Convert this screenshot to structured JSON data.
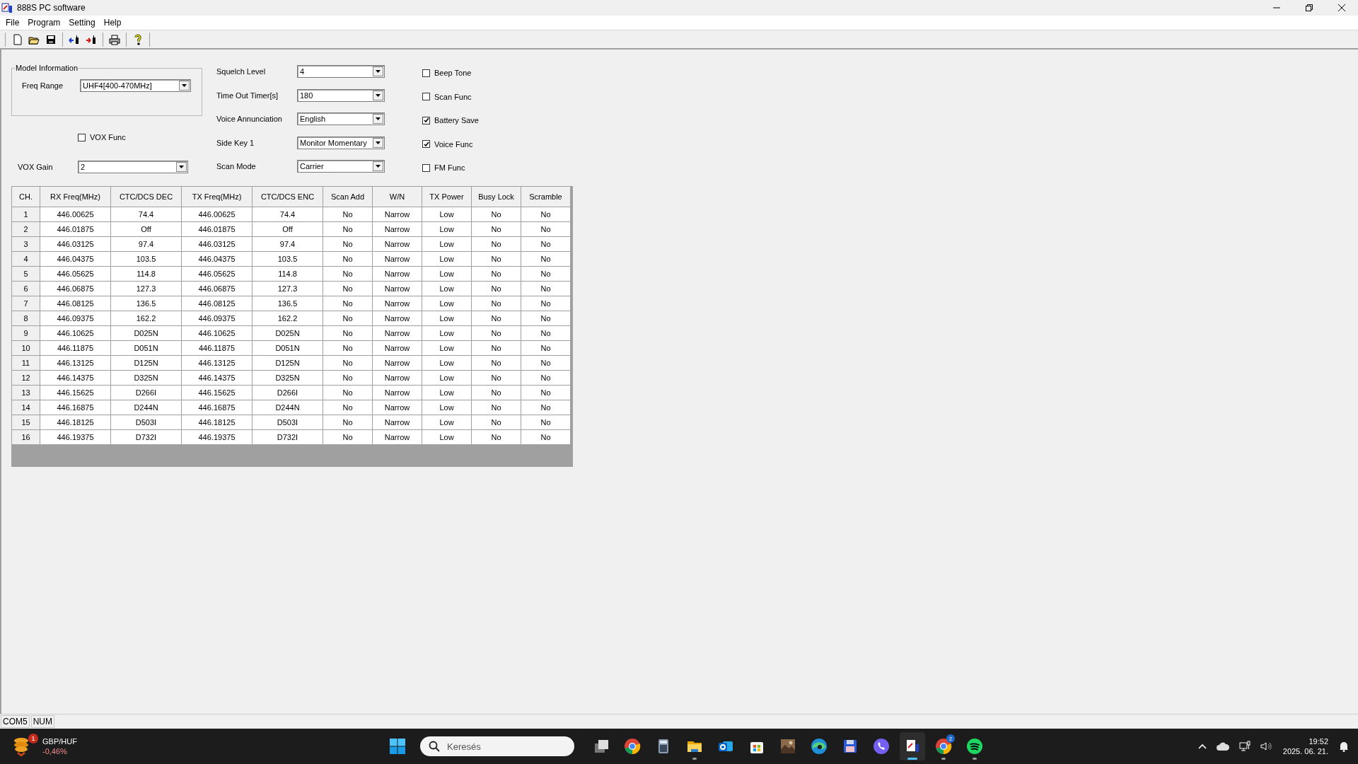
{
  "window": {
    "title": "888S PC software"
  },
  "menu": [
    "File",
    "Program",
    "Setting",
    "Help"
  ],
  "model_information": {
    "title": "Model Information",
    "freq_range": {
      "label": "Freq Range",
      "value": "UHF4[400-470MHz]"
    }
  },
  "vox_func": {
    "label": "VOX Func",
    "checked": false
  },
  "vox_gain": {
    "label": "VOX Gain",
    "value": "2"
  },
  "settings": [
    {
      "label": "Squelch Level",
      "value": "4"
    },
    {
      "label": "Time Out Timer[s]",
      "value": "180"
    },
    {
      "label": "Voice Annunciation",
      "value": "English"
    },
    {
      "label": "Side Key 1",
      "value": "Monitor Momentary"
    },
    {
      "label": "Scan Mode",
      "value": "Carrier"
    }
  ],
  "options": [
    {
      "label": "Beep Tone",
      "checked": false
    },
    {
      "label": "Scan Func",
      "checked": false
    },
    {
      "label": "Battery Save",
      "checked": true
    },
    {
      "label": "Voice Func",
      "checked": true
    },
    {
      "label": "FM Func",
      "checked": false
    }
  ],
  "table": {
    "columns": [
      "CH.",
      "RX Freq(MHz)",
      "CTC/DCS DEC",
      "TX Freq(MHz)",
      "CTC/DCS ENC",
      "Scan Add",
      "W/N",
      "TX Power",
      "Busy Lock",
      "Scramble"
    ],
    "rows": [
      [
        "1",
        "446.00625",
        "74.4",
        "446.00625",
        "74.4",
        "No",
        "Narrow",
        "Low",
        "No",
        "No"
      ],
      [
        "2",
        "446.01875",
        "Off",
        "446.01875",
        "Off",
        "No",
        "Narrow",
        "Low",
        "No",
        "No"
      ],
      [
        "3",
        "446.03125",
        "97.4",
        "446.03125",
        "97.4",
        "No",
        "Narrow",
        "Low",
        "No",
        "No"
      ],
      [
        "4",
        "446.04375",
        "103.5",
        "446.04375",
        "103.5",
        "No",
        "Narrow",
        "Low",
        "No",
        "No"
      ],
      [
        "5",
        "446.05625",
        "114.8",
        "446.05625",
        "114.8",
        "No",
        "Narrow",
        "Low",
        "No",
        "No"
      ],
      [
        "6",
        "446.06875",
        "127.3",
        "446.06875",
        "127.3",
        "No",
        "Narrow",
        "Low",
        "No",
        "No"
      ],
      [
        "7",
        "446.08125",
        "136.5",
        "446.08125",
        "136.5",
        "No",
        "Narrow",
        "Low",
        "No",
        "No"
      ],
      [
        "8",
        "446.09375",
        "162.2",
        "446.09375",
        "162.2",
        "No",
        "Narrow",
        "Low",
        "No",
        "No"
      ],
      [
        "9",
        "446.10625",
        "D025N",
        "446.10625",
        "D025N",
        "No",
        "Narrow",
        "Low",
        "No",
        "No"
      ],
      [
        "10",
        "446.11875",
        "D051N",
        "446.11875",
        "D051N",
        "No",
        "Narrow",
        "Low",
        "No",
        "No"
      ],
      [
        "11",
        "446.13125",
        "D125N",
        "446.13125",
        "D125N",
        "No",
        "Narrow",
        "Low",
        "No",
        "No"
      ],
      [
        "12",
        "446.14375",
        "D325N",
        "446.14375",
        "D325N",
        "No",
        "Narrow",
        "Low",
        "No",
        "No"
      ],
      [
        "13",
        "446.15625",
        "D266I",
        "446.15625",
        "D266I",
        "No",
        "Narrow",
        "Low",
        "No",
        "No"
      ],
      [
        "14",
        "446.16875",
        "D244N",
        "446.16875",
        "D244N",
        "No",
        "Narrow",
        "Low",
        "No",
        "No"
      ],
      [
        "15",
        "446.18125",
        "D503I",
        "446.18125",
        "D503I",
        "No",
        "Narrow",
        "Low",
        "No",
        "No"
      ],
      [
        "16",
        "446.19375",
        "D732I",
        "446.19375",
        "D732I",
        "No",
        "Narrow",
        "Low",
        "No",
        "No"
      ]
    ]
  },
  "status_bar": [
    "COM5",
    "NUM"
  ],
  "taskbar": {
    "widget": {
      "badge": "1",
      "title": "GBP/HUF",
      "change": "-0,46%"
    },
    "search": {
      "placeholder": "Keresés"
    },
    "apps": [
      {
        "kind": "taskview",
        "running": false,
        "active": false
      },
      {
        "kind": "chrome",
        "running": false,
        "active": false
      },
      {
        "kind": "calculator",
        "running": false,
        "active": false
      },
      {
        "kind": "folder",
        "running": true,
        "active": false
      },
      {
        "kind": "mail",
        "running": false,
        "active": false
      },
      {
        "kind": "store",
        "running": false,
        "active": false
      },
      {
        "kind": "photo",
        "running": false,
        "active": false
      },
      {
        "kind": "edge",
        "running": false,
        "active": false
      },
      {
        "kind": "floppy",
        "running": false,
        "active": false
      },
      {
        "kind": "phone",
        "running": false,
        "active": false
      },
      {
        "kind": "radio",
        "running": true,
        "active": true
      },
      {
        "kind": "chrome",
        "running": true,
        "active": false,
        "badge": "2"
      },
      {
        "kind": "music",
        "running": true,
        "active": false
      }
    ],
    "time": "19:52",
    "date": "2025. 06. 21."
  }
}
